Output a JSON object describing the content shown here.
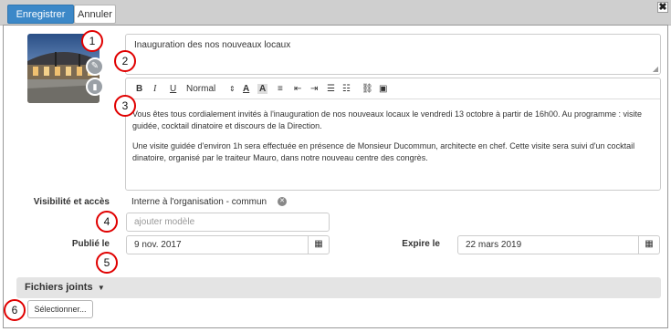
{
  "toolbar": {
    "save_label": "Enregistrer",
    "cancel_label": "Annuler",
    "close_glyph": "✖"
  },
  "title": {
    "value": "Inauguration des nos nouveaux locaux"
  },
  "editor": {
    "format_label": "Normal",
    "paragraph1": "Vous êtes tous cordialement invités à l'inauguration de nos nouveaux locaux le vendredi 13 octobre à partir de 16h00. Au programme : visite guidée, cocktail dinatoire et discours de la Direction.",
    "paragraph2": "Une visite guidée d'environ 1h sera effectuée en présence de Monsieur Ducommun, architecte en chef. Cette visite sera suivi d'un cocktail dinatoire, organisé par le traiteur Mauro, dans notre nouveau centre des congrès."
  },
  "visibility": {
    "label": "Visibilité et accès",
    "value": "Interne à l'organisation - commun",
    "template_placeholder": "ajouter modèle"
  },
  "published": {
    "label": "Publié le",
    "value": "9 nov. 2017"
  },
  "expires": {
    "label": "Expire le",
    "value": "22 mars 2019"
  },
  "attachments": {
    "label": "Fichiers joints",
    "select_label": "Sélectionner..."
  },
  "callouts": [
    "1",
    "2",
    "3",
    "4",
    "5",
    "6"
  ],
  "colors": {
    "primary": "#3c88c8",
    "callout": "#e00000"
  }
}
